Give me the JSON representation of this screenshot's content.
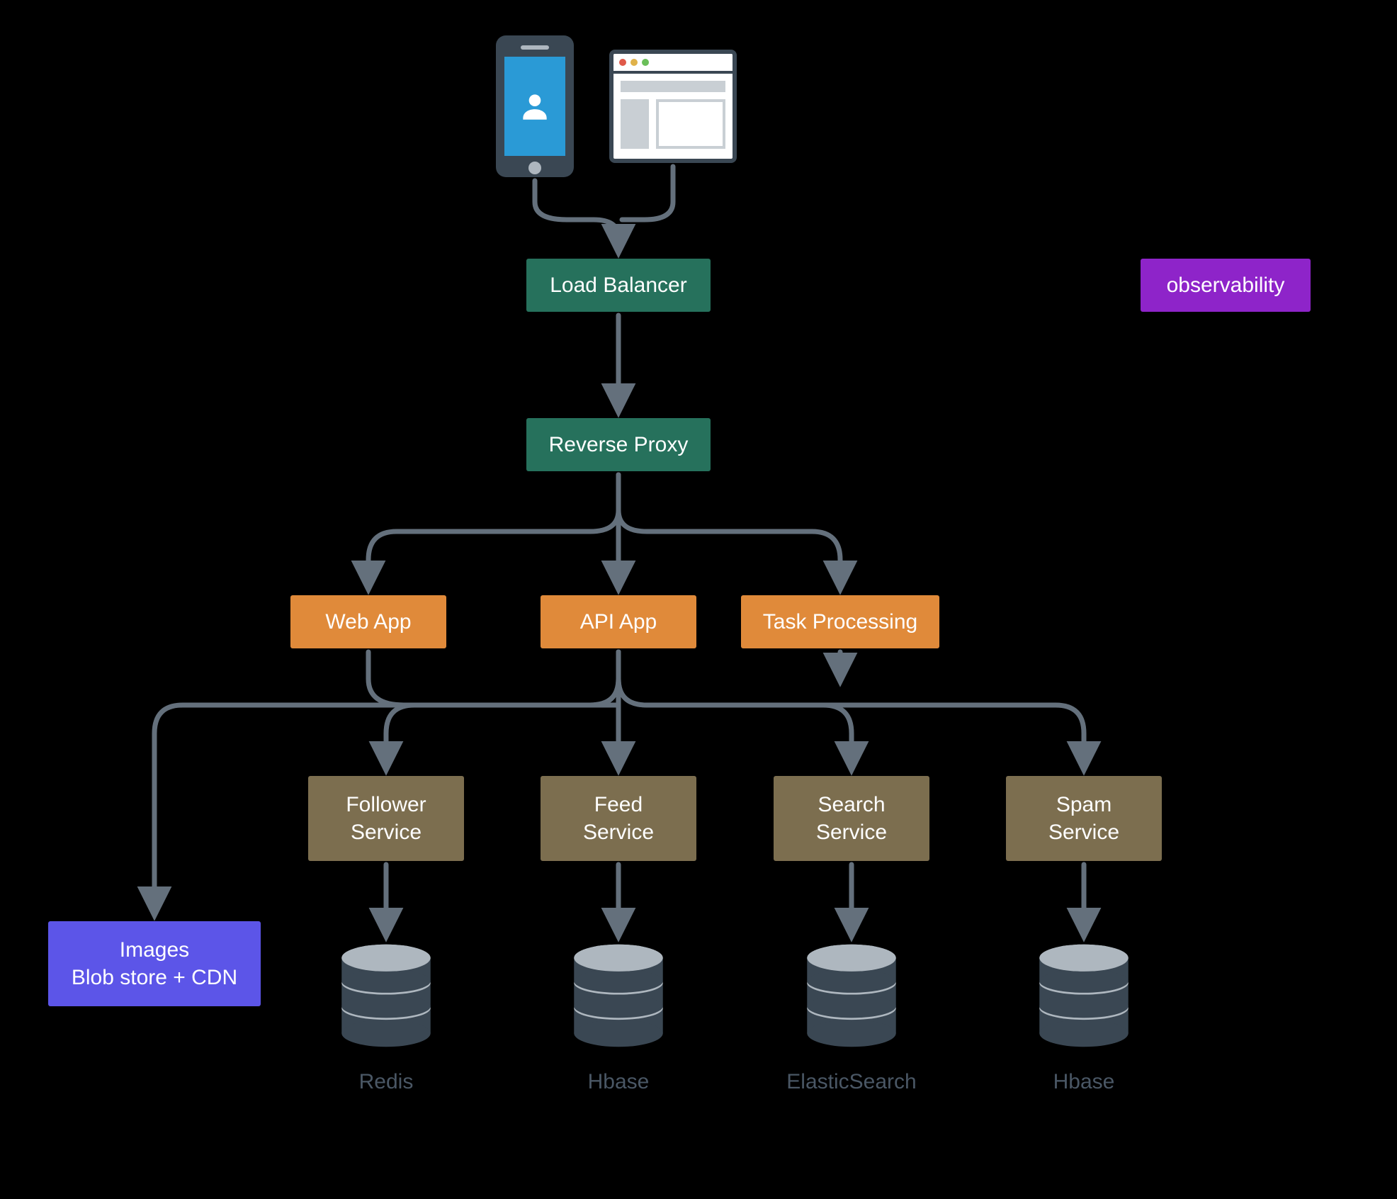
{
  "nodes": {
    "load_balancer": "Load Balancer",
    "reverse_proxy": "Reverse Proxy",
    "web_app": "Web App",
    "api_app": "API App",
    "task_processing": "Task Processing",
    "follower_service_l1": "Follower",
    "follower_service_l2": "Service",
    "feed_service_l1": "Feed",
    "feed_service_l2": "Service",
    "search_service_l1": "Search",
    "search_service_l2": "Service",
    "spam_service_l1": "Spam",
    "spam_service_l2": "Service",
    "images_l1": "Images",
    "images_l2": "Blob store + CDN",
    "observability": "observability"
  },
  "db_labels": {
    "redis": "Redis",
    "hbase1": "Hbase",
    "elasticsearch": "ElasticSearch",
    "hbase2": "Hbase"
  },
  "colors": {
    "green": "#26715c",
    "orange": "#e08a3a",
    "olive": "#7c6e4f",
    "purple": "#8e24c9",
    "blue": "#5c55e8",
    "arrow": "#64707c",
    "db_body": "#3a4753",
    "db_top": "#aeb7bf",
    "label": "#4a5765"
  }
}
